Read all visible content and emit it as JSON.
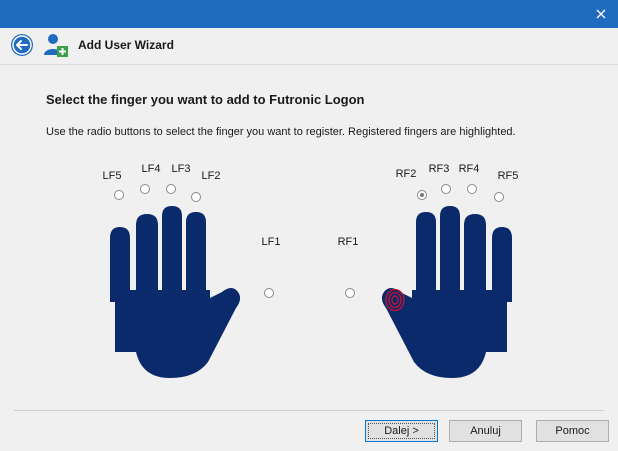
{
  "window": {
    "close_glyph": "×"
  },
  "header": {
    "title": "Add User Wizard",
    "back_icon": "back-arrow-icon",
    "user_icon": "add-user-icon"
  },
  "main": {
    "title": "Select the finger you want to add to Futronic Logon",
    "instructions": "Use the radio buttons to select the finger you want to register. Registered fingers are highlighted."
  },
  "fingers": {
    "LF5": {
      "label": "LF5",
      "checked": false
    },
    "LF4": {
      "label": "LF4",
      "checked": false
    },
    "LF3": {
      "label": "LF3",
      "checked": false
    },
    "LF2": {
      "label": "LF2",
      "checked": false
    },
    "LF1": {
      "label": "LF1",
      "checked": false
    },
    "RF1": {
      "label": "RF1",
      "checked": false,
      "registered": true
    },
    "RF2": {
      "label": "RF2",
      "checked": true
    },
    "RF3": {
      "label": "RF3",
      "checked": false
    },
    "RF4": {
      "label": "RF4",
      "checked": false
    },
    "RF5": {
      "label": "RF5",
      "checked": false
    }
  },
  "colors": {
    "hand": "#0b2a6b",
    "registered_print": "#c8102e",
    "titlebar": "#1e6bbf"
  },
  "buttons": {
    "next": "Dalej >",
    "cancel": "Anuluj",
    "help": "Pomoc"
  }
}
